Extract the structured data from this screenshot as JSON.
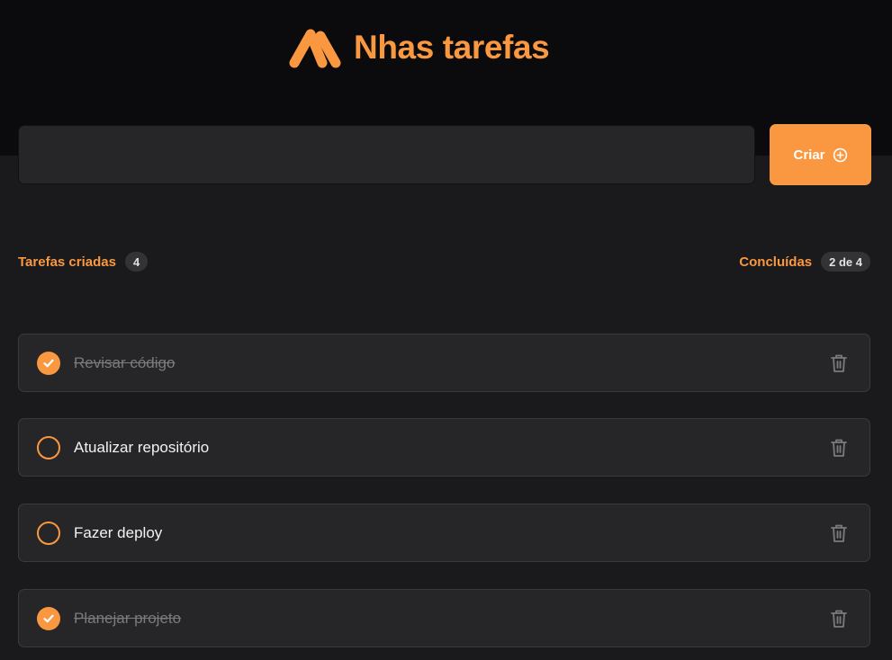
{
  "app": {
    "title": "Nhas tarefas",
    "accent_color": "#f99840",
    "logo_icon": "logo-mark-icon"
  },
  "new_task": {
    "value": "",
    "placeholder": "",
    "create_label": "Criar",
    "create_icon": "plus-circle-icon"
  },
  "counters": {
    "created_label": "Tarefas criadas",
    "created_count": "4",
    "done_label": "Concluídas",
    "done_count": "2 de 4"
  },
  "tasks": [
    {
      "text": "Revisar código",
      "completed": true
    },
    {
      "text": "Atualizar repositório",
      "completed": false
    },
    {
      "text": "Fazer deploy",
      "completed": false
    },
    {
      "text": "Planejar projeto",
      "completed": true
    }
  ],
  "icons": {
    "done": "check-icon",
    "todo": "empty-circle-icon",
    "delete": "trash-icon"
  }
}
